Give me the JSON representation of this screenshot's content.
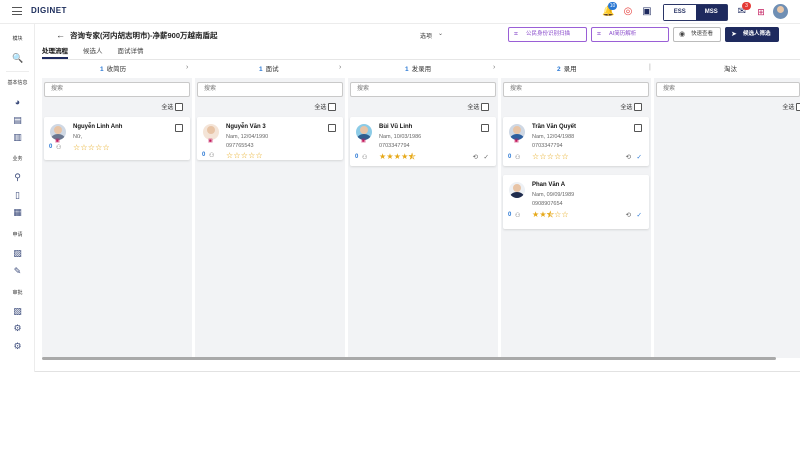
{
  "topbar": {
    "logo": "DIGINET",
    "notif_badge": "10",
    "chat_badge": "3",
    "seg_ess": "ESS",
    "seg_mss": "MSS"
  },
  "sidebar": {
    "module_label": "模块",
    "basic_info_label": "基本信息",
    "business_label": "业务",
    "apply_label": "申请",
    "approve_label": "审批"
  },
  "header": {
    "title": "咨询专家(河内胡志明市)-净薪900万越南盾起",
    "select_value": "选项",
    "btn_id_scan": "公民身份识别扫描",
    "btn_ai_resume": "AI简历解析",
    "btn_quick_view": "快速查看",
    "btn_add_candidate": "候选人筛选"
  },
  "tabs": [
    {
      "label": "处理流程",
      "active": true
    },
    {
      "label": "候选人",
      "active": false
    },
    {
      "label": "面试详情",
      "active": false
    }
  ],
  "columns": [
    {
      "count": "1",
      "name": "收简历",
      "search_placeholder": "搜索",
      "select_all": "全选",
      "cards": [
        {
          "name": "Nguyễn Linh Anh",
          "line1": "Nữ,",
          "line2": "",
          "stars": 0,
          "count": "0",
          "actions": false
        }
      ]
    },
    {
      "count": "1",
      "name": "面试",
      "search_placeholder": "搜索",
      "select_all": "全选",
      "cards": [
        {
          "name": "Nguyễn Văn 3",
          "line1": "Nam, 12/04/1990",
          "line2": "097765543",
          "stars": 0,
          "count": "0",
          "actions": false
        }
      ]
    },
    {
      "count": "1",
      "name": "发录用",
      "search_placeholder": "搜索",
      "select_all": "全选",
      "cards": [
        {
          "name": "Bùi Vũ Linh",
          "line1": "Nam, 10/03/1986",
          "line2": "0703347794",
          "stars": 4.5,
          "count": "0",
          "actions": true
        }
      ]
    },
    {
      "count": "2",
      "name": "录用",
      "search_placeholder": "搜索",
      "select_all": "全选",
      "cards": [
        {
          "name": "Trần Văn Quyết",
          "line1": "Nam, 12/04/1988",
          "line2": "0703347794",
          "stars": 0,
          "count": "0",
          "actions": true
        },
        {
          "name": "Phan Văn A",
          "line1": "Nam, 09/09/1989",
          "line2": "0908907654",
          "stars": 2.5,
          "count": "0",
          "actions": true
        }
      ]
    },
    {
      "count": "",
      "name": "淘汰",
      "search_placeholder": "搜索",
      "select_all": "全选",
      "cards": []
    }
  ],
  "icons": {
    "bell": "bell-icon",
    "target": "target-icon",
    "book": "book-icon",
    "chat": "chat-icon",
    "apps": "apps-icon",
    "calendar": "calendar-icon",
    "history": "history-icon",
    "check": "check-icon"
  },
  "colors": {
    "navy": "#1e2a5e",
    "accent_blue": "#2a78d4",
    "purple": "#8a4ccc",
    "star": "#e6a818",
    "badge_blue": "#2a78d4",
    "badge_red": "#e53935"
  }
}
